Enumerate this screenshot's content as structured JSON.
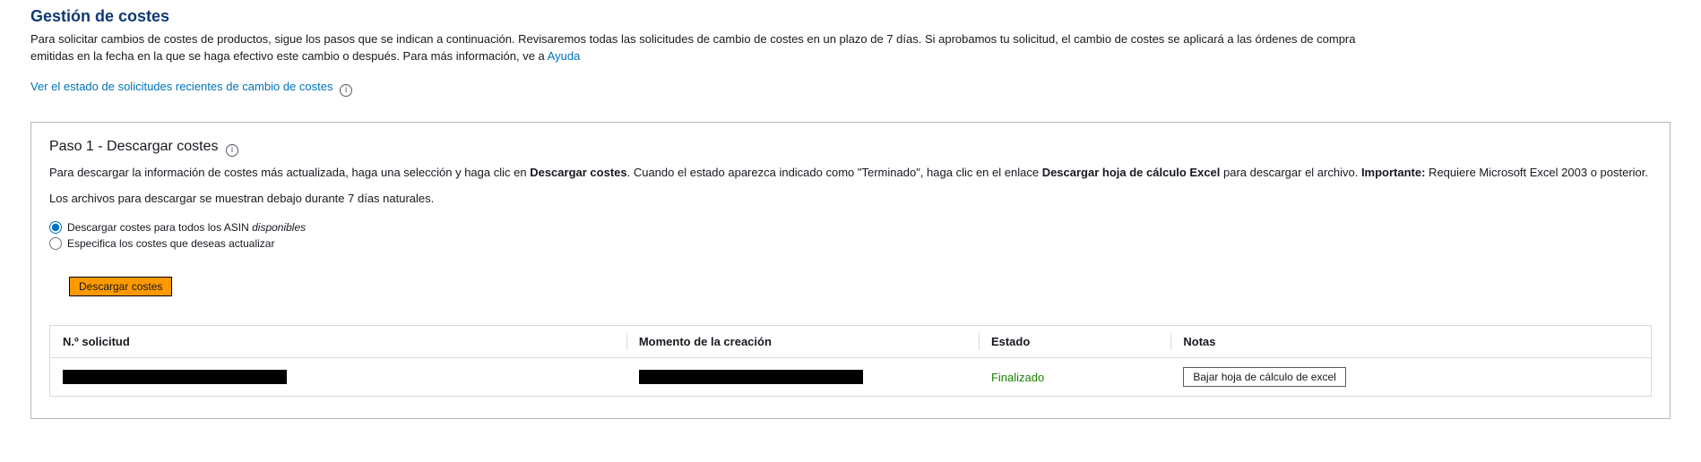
{
  "header": {
    "title": "Gestión de costes",
    "intro_prefix": "Para solicitar cambios de costes de productos, sigue los pasos que se indican a continuación. Revisaremos todas las solicitudes de cambio de costes en un plazo de 7 días. Si aprobamos tu solicitud, el cambio de costes se aplicará a las órdenes de compra emitidas en la fecha en la que se haga efectivo este cambio o después. Para más información, ve a ",
    "help_link": "Ayuda",
    "status_link": "Ver el estado de solicitudes recientes de cambio de costes"
  },
  "step1": {
    "title": "Paso 1 - Descargar costes",
    "desc_1": "Para descargar la información de costes más actualizada, haga una selección y haga clic en ",
    "desc_bold1": "Descargar costes",
    "desc_2": ". Cuando el estado aparezca indicado como \"Terminado\", haga clic en el enlace ",
    "desc_bold2": "Descargar hoja de cálculo Excel",
    "desc_3": " para descargar el archivo. ",
    "desc_bold3": "Importante:",
    "desc_4": " Requiere Microsoft Excel 2003 o posterior.",
    "note": "Los archivos para descargar se muestran debajo durante 7 días naturales.",
    "radio1_prefix": "Descargar costes para todos los ASIN ",
    "radio1_italic": "disponibles",
    "radio2": "Especifica los costes que deseas actualizar",
    "download_btn": "Descargar costes"
  },
  "table": {
    "headers": {
      "request": "N.º solicitud",
      "created": "Momento de la creación",
      "status": "Estado",
      "notes": "Notas"
    },
    "row": {
      "status": "Finalizado",
      "download": "Bajar hoja de cálculo de excel"
    }
  }
}
